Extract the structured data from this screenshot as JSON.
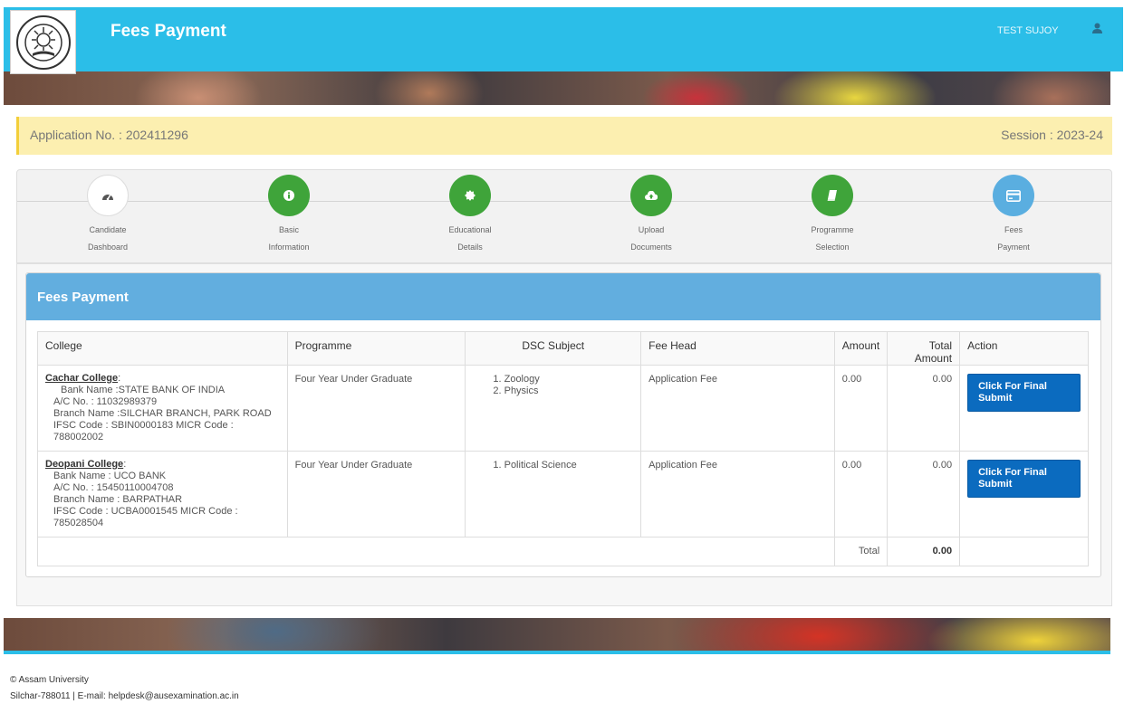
{
  "header": {
    "title": "Fees Payment",
    "user_name": "TEST SUJOY"
  },
  "application": {
    "number_text": "Application No. : 202411296",
    "session_text": "Session : 2023-24"
  },
  "steps": [
    {
      "line1": "Candidate",
      "line2": "Dashboard",
      "icon": "dashboard-icon",
      "state": "default"
    },
    {
      "line1": "Basic",
      "line2": "Information",
      "icon": "info-icon",
      "state": "done"
    },
    {
      "line1": "Educational",
      "line2": "Details",
      "icon": "badge-icon",
      "state": "done"
    },
    {
      "line1": "Upload",
      "line2": "Documents",
      "icon": "cloud-upload-icon",
      "state": "done"
    },
    {
      "line1": "Programme",
      "line2": "Selection",
      "icon": "book-icon",
      "state": "done"
    },
    {
      "line1": "Fees",
      "line2": "Payment",
      "icon": "credit-card-icon",
      "state": "active"
    }
  ],
  "fees": {
    "title": "Fees Payment",
    "columns": [
      "College",
      "Programme",
      "DSC Subject",
      "Fee Head",
      "Amount",
      "Total Amount",
      "Action"
    ],
    "rows": [
      {
        "college_name": "Cachar College",
        "bank_name": "Bank Name :STATE BANK OF INDIA",
        "account": "A/C No. : 11032989379",
        "branch": "Branch Name :SILCHAR BRANCH, PARK ROAD",
        "codes": "IFSC Code : SBIN0000183 MICR Code : 788002002",
        "programme": "Four Year Under Graduate",
        "subjects": [
          "1. Zoology",
          "2. Physics"
        ],
        "fee_head": "Application Fee",
        "amount": "0.00",
        "total_amount": "0.00",
        "action_label": "Click For Final Submit"
      },
      {
        "college_name": "Deopani College",
        "bank_name": "Bank Name : UCO BANK",
        "account": "A/C No. : 15450110004708",
        "branch": "Branch Name : BARPATHAR",
        "codes": "IFSC Code : UCBA0001545 MICR Code : 785028504",
        "programme": "Four Year Under Graduate",
        "subjects": [
          "1. Political Science"
        ],
        "fee_head": "Application Fee",
        "amount": "0.00",
        "total_amount": "0.00",
        "action_label": "Click For Final Submit"
      }
    ],
    "total_label": "Total",
    "total_value": "0.00"
  },
  "footer": {
    "copyright": "© Assam University",
    "contact": "Silchar-788011 | E-mail: helpdesk@ausexamination.ac.in"
  },
  "colors": {
    "header": "#2bbee8",
    "step_done": "#3fa43a",
    "step_active": "#5aaee0",
    "button": "#0b6bbf",
    "app_bar": "#fcefb0"
  }
}
